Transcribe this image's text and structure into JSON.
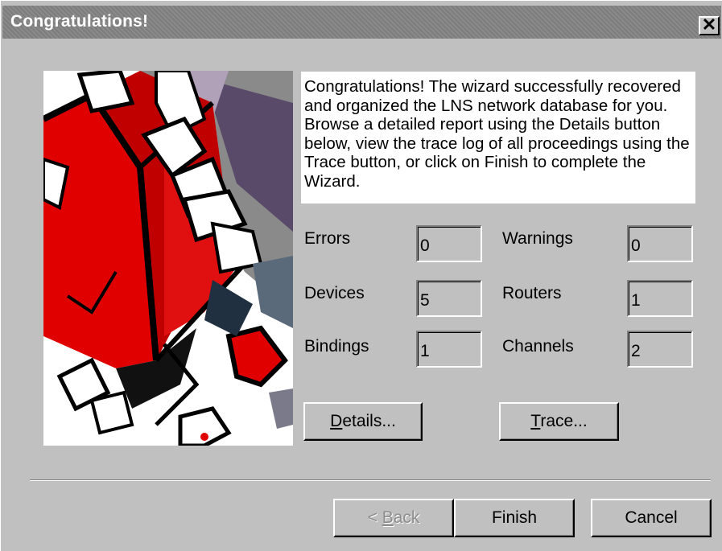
{
  "window": {
    "title": "Congratulations!",
    "close_glyph": "✕"
  },
  "description": "Congratulations! The wizard successfully recovered and organized the LNS network database for you. Browse a detailed report using the Details button below, view the trace log of all proceedings using the Trace button, or click on Finish to complete the Wizard.",
  "stats": {
    "errors": {
      "label": "Errors",
      "value": "0"
    },
    "warnings": {
      "label": "Warnings",
      "value": "0"
    },
    "devices": {
      "label": "Devices",
      "value": "5"
    },
    "routers": {
      "label": "Routers",
      "value": "1"
    },
    "bindings": {
      "label": "Bindings",
      "value": "1"
    },
    "channels": {
      "label": "Channels",
      "value": "2"
    }
  },
  "buttons": {
    "details": {
      "accel": "D",
      "rest": "etails..."
    },
    "trace": {
      "accel": "T",
      "rest": "race..."
    },
    "back": {
      "prefix": "< ",
      "accel": "B",
      "rest": "ack"
    },
    "finish": "Finish",
    "cancel": "Cancel"
  },
  "colors": {
    "titlebar": "#808080",
    "face": "#c0c0c0",
    "art_red": "#e00000"
  }
}
